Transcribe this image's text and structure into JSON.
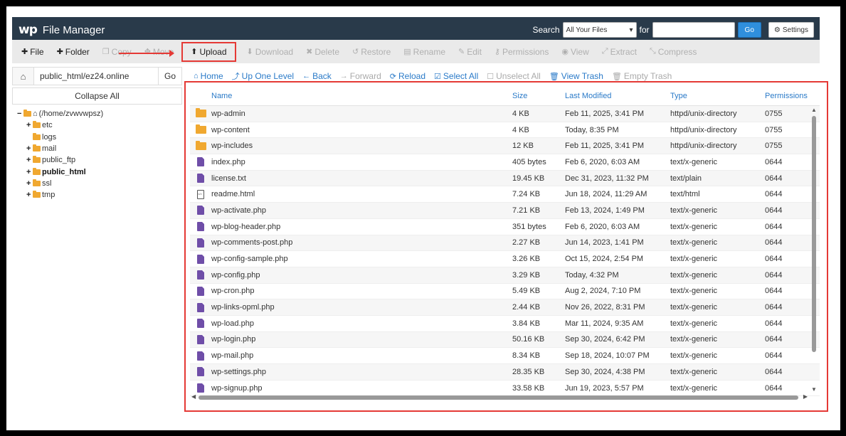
{
  "header": {
    "logo": "wp",
    "title": "File Manager",
    "search_label": "Search",
    "search_scope": "All Your Files",
    "for_label": "for",
    "search_value": "",
    "go_label": "Go",
    "settings_label": "Settings"
  },
  "toolbar": {
    "items": [
      {
        "label": "File",
        "icon": "plus-icon",
        "enabled": true
      },
      {
        "label": "Folder",
        "icon": "plus-icon",
        "enabled": true
      },
      {
        "label": "Copy",
        "icon": "copy-icon",
        "enabled": false
      },
      {
        "label": "Move",
        "icon": "move-icon",
        "enabled": false
      },
      {
        "label": "Upload",
        "icon": "upload-icon",
        "enabled": true
      },
      {
        "label": "Download",
        "icon": "download-icon",
        "enabled": false
      },
      {
        "label": "Delete",
        "icon": "delete-icon",
        "enabled": false
      },
      {
        "label": "Restore",
        "icon": "restore-icon",
        "enabled": false
      },
      {
        "label": "Rename",
        "icon": "rename-icon",
        "enabled": false
      },
      {
        "label": "Edit",
        "icon": "pencil-icon",
        "enabled": false
      },
      {
        "label": "Permissions",
        "icon": "key-icon",
        "enabled": false
      },
      {
        "label": "View",
        "icon": "eye-icon",
        "enabled": false
      },
      {
        "label": "Extract",
        "icon": "extract-icon",
        "enabled": false
      },
      {
        "label": "Compress",
        "icon": "compress-icon",
        "enabled": false
      }
    ]
  },
  "sidebar": {
    "path_value": "public_html/ez24.online",
    "go_label": "Go",
    "collapse_label": "Collapse All",
    "tree": [
      {
        "label": "(/home/zvwvwpsz)",
        "prefix": "−",
        "level": 0,
        "bold": false
      },
      {
        "label": "etc",
        "prefix": "+",
        "level": 1,
        "bold": false
      },
      {
        "label": "logs",
        "prefix": "",
        "level": 1,
        "bold": false
      },
      {
        "label": "mail",
        "prefix": "+",
        "level": 1,
        "bold": false
      },
      {
        "label": "public_ftp",
        "prefix": "+",
        "level": 1,
        "bold": false
      },
      {
        "label": "public_html",
        "prefix": "+",
        "level": 1,
        "bold": true
      },
      {
        "label": "ssl",
        "prefix": "+",
        "level": 1,
        "bold": false
      },
      {
        "label": "tmp",
        "prefix": "+",
        "level": 1,
        "bold": false
      }
    ]
  },
  "nav": {
    "items": [
      {
        "label": "Home",
        "icon": "home-icon",
        "enabled": true
      },
      {
        "label": "Up One Level",
        "icon": "up-level-icon",
        "enabled": true
      },
      {
        "label": "Back",
        "icon": "arrow-left-icon",
        "enabled": true
      },
      {
        "label": "Forward",
        "icon": "arrow-right-icon",
        "enabled": false
      },
      {
        "label": "Reload",
        "icon": "reload-icon",
        "enabled": true
      },
      {
        "label": "Select All",
        "icon": "checkbox-checked-icon",
        "enabled": true
      },
      {
        "label": "Unselect All",
        "icon": "checkbox-icon",
        "enabled": false
      },
      {
        "label": "View Trash",
        "icon": "trash-icon",
        "enabled": true
      },
      {
        "label": "Empty Trash",
        "icon": "trash-icon",
        "enabled": false
      }
    ]
  },
  "table": {
    "columns": [
      "Name",
      "Size",
      "Last Modified",
      "Type",
      "Permissions"
    ],
    "rows": [
      {
        "kind": "folder",
        "name": "wp-admin",
        "size": "4 KB",
        "modified": "Feb 11, 2025, 3:41 PM",
        "type": "httpd/unix-directory",
        "perm": "0755"
      },
      {
        "kind": "folder",
        "name": "wp-content",
        "size": "4 KB",
        "modified": "Today, 8:35 PM",
        "type": "httpd/unix-directory",
        "perm": "0755"
      },
      {
        "kind": "folder",
        "name": "wp-includes",
        "size": "12 KB",
        "modified": "Feb 11, 2025, 3:41 PM",
        "type": "httpd/unix-directory",
        "perm": "0755"
      },
      {
        "kind": "php",
        "name": "index.php",
        "size": "405 bytes",
        "modified": "Feb 6, 2020, 6:03 AM",
        "type": "text/x-generic",
        "perm": "0644"
      },
      {
        "kind": "php",
        "name": "license.txt",
        "size": "19.45 KB",
        "modified": "Dec 31, 2023, 11:32 PM",
        "type": "text/plain",
        "perm": "0644"
      },
      {
        "kind": "html",
        "name": "readme.html",
        "size": "7.24 KB",
        "modified": "Jun 18, 2024, 11:29 AM",
        "type": "text/html",
        "perm": "0644"
      },
      {
        "kind": "php",
        "name": "wp-activate.php",
        "size": "7.21 KB",
        "modified": "Feb 13, 2024, 1:49 PM",
        "type": "text/x-generic",
        "perm": "0644"
      },
      {
        "kind": "php",
        "name": "wp-blog-header.php",
        "size": "351 bytes",
        "modified": "Feb 6, 2020, 6:03 AM",
        "type": "text/x-generic",
        "perm": "0644"
      },
      {
        "kind": "php",
        "name": "wp-comments-post.php",
        "size": "2.27 KB",
        "modified": "Jun 14, 2023, 1:41 PM",
        "type": "text/x-generic",
        "perm": "0644"
      },
      {
        "kind": "php",
        "name": "wp-config-sample.php",
        "size": "3.26 KB",
        "modified": "Oct 15, 2024, 2:54 PM",
        "type": "text/x-generic",
        "perm": "0644"
      },
      {
        "kind": "php",
        "name": "wp-config.php",
        "size": "3.29 KB",
        "modified": "Today, 4:32 PM",
        "type": "text/x-generic",
        "perm": "0644"
      },
      {
        "kind": "php",
        "name": "wp-cron.php",
        "size": "5.49 KB",
        "modified": "Aug 2, 2024, 7:10 PM",
        "type": "text/x-generic",
        "perm": "0644"
      },
      {
        "kind": "php",
        "name": "wp-links-opml.php",
        "size": "2.44 KB",
        "modified": "Nov 26, 2022, 8:31 PM",
        "type": "text/x-generic",
        "perm": "0644"
      },
      {
        "kind": "php",
        "name": "wp-load.php",
        "size": "3.84 KB",
        "modified": "Mar 11, 2024, 9:35 AM",
        "type": "text/x-generic",
        "perm": "0644"
      },
      {
        "kind": "php",
        "name": "wp-login.php",
        "size": "50.16 KB",
        "modified": "Sep 30, 2024, 6:42 PM",
        "type": "text/x-generic",
        "perm": "0644"
      },
      {
        "kind": "php",
        "name": "wp-mail.php",
        "size": "8.34 KB",
        "modified": "Sep 18, 2024, 10:07 PM",
        "type": "text/x-generic",
        "perm": "0644"
      },
      {
        "kind": "php",
        "name": "wp-settings.php",
        "size": "28.35 KB",
        "modified": "Sep 30, 2024, 4:38 PM",
        "type": "text/x-generic",
        "perm": "0644"
      },
      {
        "kind": "php",
        "name": "wp-signup.php",
        "size": "33.58 KB",
        "modified": "Jun 19, 2023, 5:57 PM",
        "type": "text/x-generic",
        "perm": "0644"
      }
    ]
  },
  "colors": {
    "header_bg": "#293a4a",
    "link": "#2a7ac8",
    "highlight": "#e53935",
    "folder": "#f0a830",
    "php_file": "#6f4ea8"
  }
}
